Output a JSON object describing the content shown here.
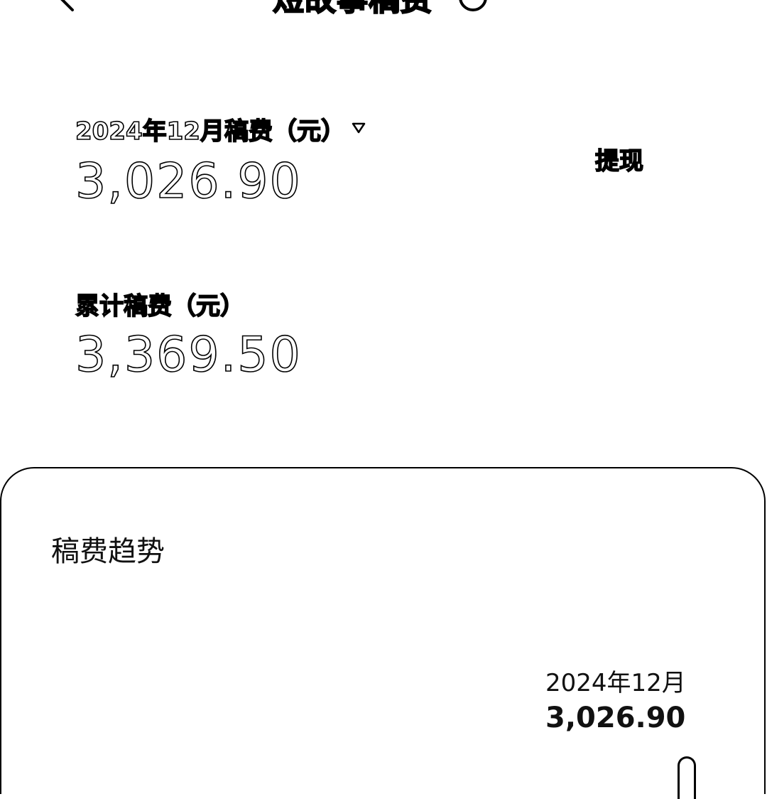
{
  "header": {
    "title": "短故事稿费",
    "back_icon": "back-arrow-icon",
    "help_icon": "help-circle-icon"
  },
  "monthly": {
    "label": "2024年12月稿费（元）",
    "value": "3,026.90",
    "dropdown_icon": "caret-down-icon",
    "withdraw_label": "提现"
  },
  "total": {
    "label": "累计稿费（元）",
    "value": "3,369.50"
  },
  "trend": {
    "title": "稿费趋势",
    "tooltip_month": "2024年12月",
    "tooltip_value": "3,026.90"
  },
  "chart_data": {
    "type": "bar",
    "categories": [
      "2024年12月"
    ],
    "values": [
      3026.9
    ],
    "title": "稿费趋势"
  }
}
